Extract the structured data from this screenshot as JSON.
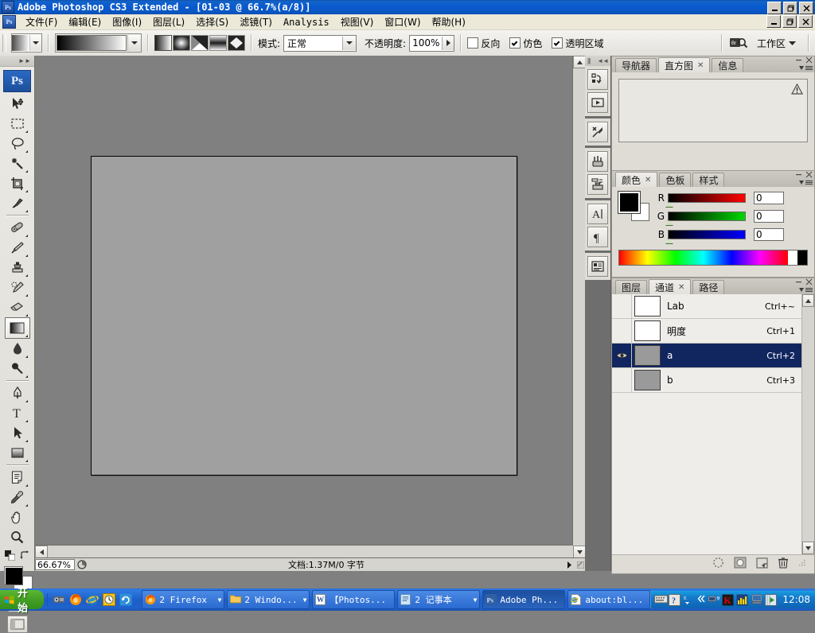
{
  "window": {
    "title": "Adobe Photoshop CS3 Extended - [01-03 @ 66.7%(a/8)]",
    "app_icon": "Ps",
    "buttons": {
      "minimize": "_",
      "restore": "□",
      "close": "×"
    }
  },
  "menubar": {
    "doc_icon": "Ps",
    "items": [
      {
        "label": "文件(F)"
      },
      {
        "label": "编辑(E)"
      },
      {
        "label": "图像(I)"
      },
      {
        "label": "图层(L)"
      },
      {
        "label": "选择(S)"
      },
      {
        "label": "滤镜(T)"
      },
      {
        "label": "Analysis"
      },
      {
        "label": "视图(V)"
      },
      {
        "label": "窗口(W)"
      },
      {
        "label": "帮助(H)"
      }
    ]
  },
  "options_bar": {
    "tool_preset_label": "gradient-tool-preset",
    "gradient_picker_label": "gradient-picker",
    "gradient_types": [
      "linear",
      "radial",
      "angle",
      "reflected",
      "diamond"
    ],
    "gradient_type_selected": 0,
    "mode_label": "模式:",
    "mode_value": "正常",
    "opacity_label": "不透明度:",
    "opacity_value": "100%",
    "checkboxes": [
      {
        "label": "反向",
        "checked": false
      },
      {
        "label": "仿色",
        "checked": true
      },
      {
        "label": "透明区域",
        "checked": true
      }
    ],
    "bridge_label": "go-to-bridge",
    "workspace_label": "工作区"
  },
  "toolbox": {
    "badge": "Ps",
    "tools": [
      {
        "name": "move-tool",
        "has_flyout": false
      },
      {
        "name": "rectangular-marquee-tool",
        "has_flyout": true
      },
      {
        "name": "lasso-tool",
        "has_flyout": true
      },
      {
        "name": "magic-wand-tool",
        "has_flyout": true
      },
      {
        "name": "crop-tool",
        "has_flyout": true
      },
      {
        "name": "slice-tool",
        "has_flyout": true
      },
      {
        "name": "healing-brush-tool",
        "has_flyout": true
      },
      {
        "name": "brush-tool",
        "has_flyout": true
      },
      {
        "name": "clone-stamp-tool",
        "has_flyout": true
      },
      {
        "name": "history-brush-tool",
        "has_flyout": true
      },
      {
        "name": "eraser-tool",
        "has_flyout": true
      },
      {
        "name": "gradient-tool",
        "has_flyout": true,
        "active": true
      },
      {
        "name": "blur-tool",
        "has_flyout": true
      },
      {
        "name": "dodge-tool",
        "has_flyout": true
      },
      {
        "name": "pen-tool",
        "has_flyout": true
      },
      {
        "name": "horizontal-type-tool",
        "has_flyout": true
      },
      {
        "name": "path-selection-tool",
        "has_flyout": true
      },
      {
        "name": "rectangle-shape-tool",
        "has_flyout": true
      },
      {
        "name": "notes-tool",
        "has_flyout": true
      },
      {
        "name": "eyedropper-tool",
        "has_flyout": true
      },
      {
        "name": "hand-tool",
        "has_flyout": false
      },
      {
        "name": "zoom-tool",
        "has_flyout": false
      }
    ],
    "foreground_color": "#000000",
    "background_color": "#ffffff",
    "quick_mask_label": "quick-mask-mode",
    "screen_mode_label": "screen-mode"
  },
  "document": {
    "canvas_color": "#a0a0a0",
    "zoom": "66.67%",
    "info": "文档:1.37M/0 字节"
  },
  "icon_dock": {
    "buttons": [
      {
        "name": "actions-icon"
      },
      {
        "name": "play-icon"
      },
      {
        "name": "tool-presets-icon"
      },
      {
        "name": "brushes-icon"
      },
      {
        "name": "clone-source-icon"
      },
      {
        "name": "character-icon"
      },
      {
        "name": "paragraph-icon"
      },
      {
        "name": "layer-comps-icon"
      }
    ]
  },
  "panels": {
    "navigator_group": {
      "tabs": [
        {
          "label": "导航器",
          "active": false,
          "closable": false
        },
        {
          "label": "直方图",
          "active": true,
          "closable": true
        },
        {
          "label": "信息",
          "active": false,
          "closable": false
        }
      ],
      "warning_icon": "warning-triangle"
    },
    "color_group": {
      "tabs": [
        {
          "label": "颜色",
          "active": true,
          "closable": true
        },
        {
          "label": "色板",
          "active": false,
          "closable": false
        },
        {
          "label": "样式",
          "active": false,
          "closable": false
        }
      ],
      "sliders": [
        {
          "label": "R",
          "value": "0"
        },
        {
          "label": "G",
          "value": "0"
        },
        {
          "label": "B",
          "value": "0"
        }
      ],
      "foreground": "#000000",
      "background": "#ffffff"
    },
    "channels_group": {
      "tabs": [
        {
          "label": "图层",
          "active": false,
          "closable": false
        },
        {
          "label": "通道",
          "active": true,
          "closable": true
        },
        {
          "label": "路径",
          "active": false,
          "closable": false
        }
      ],
      "rows": [
        {
          "name": "Lab",
          "shortcut": "Ctrl+~",
          "visible": false,
          "selected": false,
          "thumb": "#ffffff"
        },
        {
          "name": "明度",
          "shortcut": "Ctrl+1",
          "visible": false,
          "selected": false,
          "thumb": "#ffffff"
        },
        {
          "name": "a",
          "shortcut": "Ctrl+2",
          "visible": true,
          "selected": true,
          "thumb": "#9a9a9a"
        },
        {
          "name": "b",
          "shortcut": "Ctrl+3",
          "visible": false,
          "selected": false,
          "thumb": "#9a9a9a"
        }
      ],
      "footer_buttons": [
        {
          "name": "load-channel-as-selection-icon"
        },
        {
          "name": "save-selection-as-channel-icon"
        },
        {
          "name": "create-new-channel-icon"
        },
        {
          "name": "delete-channel-icon"
        }
      ]
    }
  },
  "taskbar": {
    "start_label": "开始",
    "quick_launch": [
      {
        "name": "media-player-icon"
      },
      {
        "name": "firefox-icon"
      },
      {
        "name": "internet-explorer-icon"
      },
      {
        "name": "clock-icon"
      },
      {
        "name": "refresh-icon"
      }
    ],
    "tasks": [
      {
        "label": "2 Firefox",
        "icon": "firefox-icon",
        "group": true,
        "active": false
      },
      {
        "label": "2 Windo...",
        "icon": "folder-icon",
        "group": true,
        "active": false
      },
      {
        "label": "【Photos...",
        "icon": "word-icon",
        "group": false,
        "active": false
      },
      {
        "label": "2 记事本",
        "icon": "notepad-icon",
        "group": true,
        "active": false
      },
      {
        "label": "Adobe Ph...",
        "icon": "photoshop-icon",
        "group": false,
        "active": true
      },
      {
        "label": "about:bl...",
        "icon": "ie-doc-icon",
        "group": false,
        "active": false
      }
    ],
    "tray": [
      {
        "name": "keyboard-layout-icon"
      },
      {
        "name": "help-icon"
      },
      {
        "name": "ime-status-icon"
      },
      {
        "name": "show-hidden-icons-icon"
      },
      {
        "name": "network-icon"
      },
      {
        "name": "kaspersky-icon"
      },
      {
        "name": "monitor-stats-icon"
      },
      {
        "name": "computer-icon"
      },
      {
        "name": "media-icon"
      }
    ],
    "clock": "12:08"
  }
}
